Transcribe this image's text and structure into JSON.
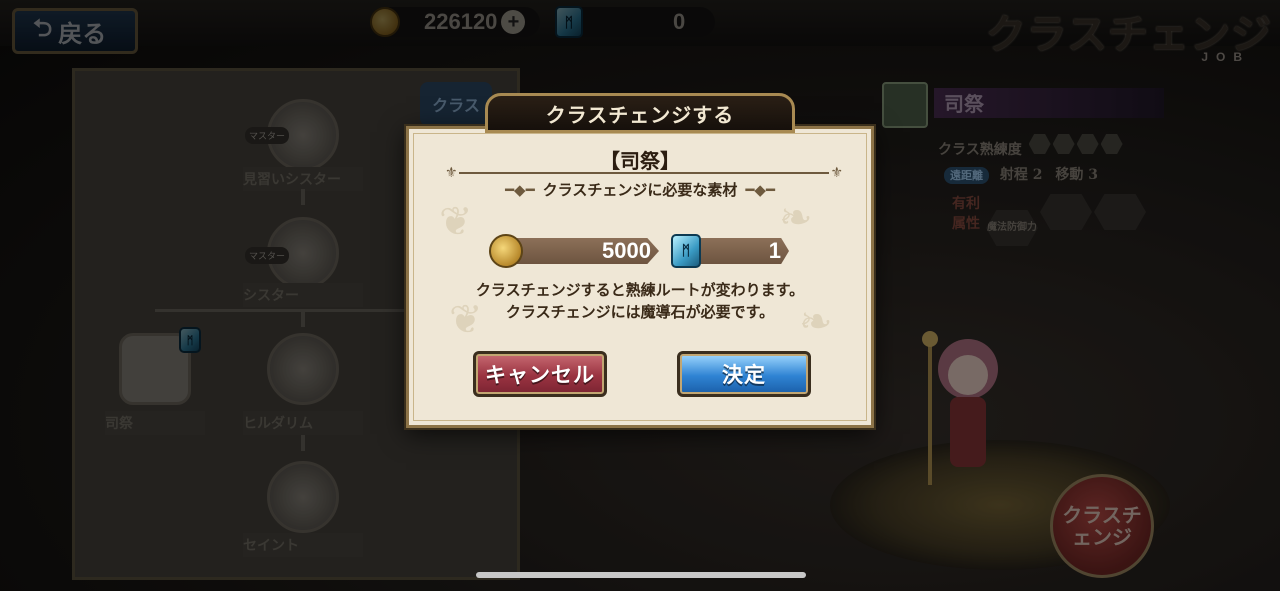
{
  "top_bar": {
    "back_label": "戻る",
    "gold": "226120",
    "magic_stones": "0",
    "screen_title": "クラスチェンジ",
    "screen_subtitle": "JOB"
  },
  "class_tree": {
    "tab_label": "クラス",
    "master_tag": "マスター",
    "nodes": [
      "見習いシスター",
      "シスター",
      "司祭",
      "ヒルダリム",
      "セイント"
    ]
  },
  "class_info": {
    "name": "司祭",
    "mastery_label": "クラス熟練度",
    "range_type": "遠距離",
    "range_label": "射程",
    "range_value": "2",
    "move_label": "移動",
    "move_value": "3",
    "advantage_label": "有利属性",
    "advantage_item": "魔法防御力"
  },
  "class_change_button": "クラスチェンジ",
  "modal": {
    "title": "クラスチェンジする",
    "job_name": "【司祭】",
    "materials_caption": "クラスチェンジに必要な素材",
    "gold_cost": "5000",
    "stone_cost": "1",
    "message_line1": "クラスチェンジすると熟練ルートが変わります。",
    "message_line2": "クラスチェンジには魔導石が必要です。",
    "cancel_label": "キャンセル",
    "confirm_label": "決定"
  },
  "colors": {
    "cancel": "#9a3341",
    "confirm": "#2f83d3",
    "modal_bg": "#efe7d6",
    "frame": "#8d7448"
  }
}
